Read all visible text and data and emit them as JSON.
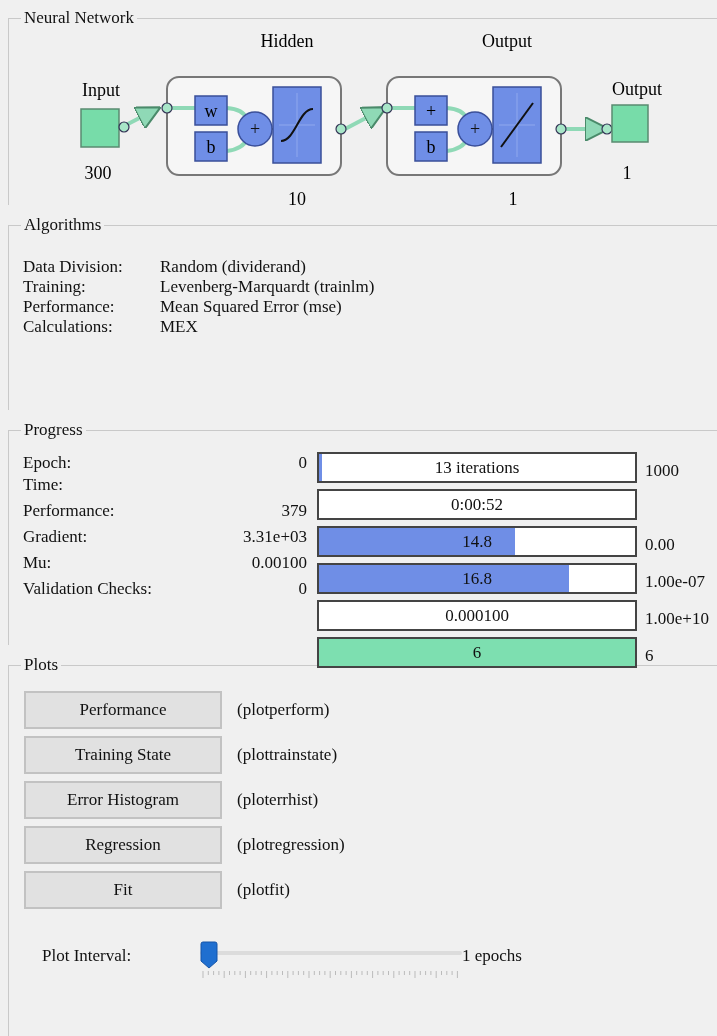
{
  "network": {
    "title": "Neural Network",
    "input": {
      "label": "Input",
      "size": "300"
    },
    "layers": [
      {
        "title": "Hidden",
        "weight": "w",
        "bias": "b",
        "sum": "+",
        "kind": "sigmoid",
        "size": "10"
      },
      {
        "title": "Output",
        "weight": "+",
        "bias": "b",
        "sum": "+",
        "kind": "linear",
        "size": "1"
      }
    ],
    "output": {
      "label": "Output",
      "size": "1"
    }
  },
  "algorithms": {
    "title": "Algorithms",
    "rows": [
      {
        "label": "Data Division:",
        "value": "Random (dividerand)"
      },
      {
        "label": "Training:",
        "value": "Levenberg-Marquardt (trainlm)"
      },
      {
        "label": "Performance:",
        "value": "Mean Squared Error (mse)"
      },
      {
        "label": "Calculations:",
        "value": "MEX"
      }
    ]
  },
  "progress": {
    "title": "Progress",
    "rows": [
      {
        "label": "Epoch:",
        "start": "0"
      },
      {
        "label": "Time:"
      },
      {
        "label": "Performance:",
        "start": "379"
      },
      {
        "label": "Gradient:",
        "start": "3.31e+03"
      },
      {
        "label": "Mu:",
        "start": "0.00100"
      },
      {
        "label": "Validation Checks:",
        "start": "0"
      }
    ],
    "bars": [
      {
        "text": "13 iterations",
        "level": 0.01,
        "color": "#6f8ee6",
        "end": "1000"
      },
      {
        "text": "0:00:52"
      },
      {
        "text": "14.8",
        "level": 0.62,
        "color": "#6f8ee6",
        "end": "0.00"
      },
      {
        "text": "16.8",
        "level": 0.79,
        "color": "#6f8ee6",
        "end": "1.00e-07"
      },
      {
        "text": "0.000100",
        "end": "1.00e+10"
      },
      {
        "text": "6",
        "level": 1,
        "color": "#7ddfb0",
        "end": "6"
      }
    ]
  },
  "plots": {
    "title": "Plots",
    "buttons": [
      {
        "label": "Performance",
        "function": "(plotperform)"
      },
      {
        "label": "Training State",
        "function": "(plottrainstate)"
      },
      {
        "label": "Error Histogram",
        "function": "(ploterrhist)"
      },
      {
        "label": "Regression",
        "function": "(plotregression)"
      },
      {
        "label": "Fit",
        "function": "(plotfit)"
      }
    ],
    "interval": {
      "label": "Plot Interval:",
      "level": 0,
      "reading": "1 epochs"
    }
  }
}
